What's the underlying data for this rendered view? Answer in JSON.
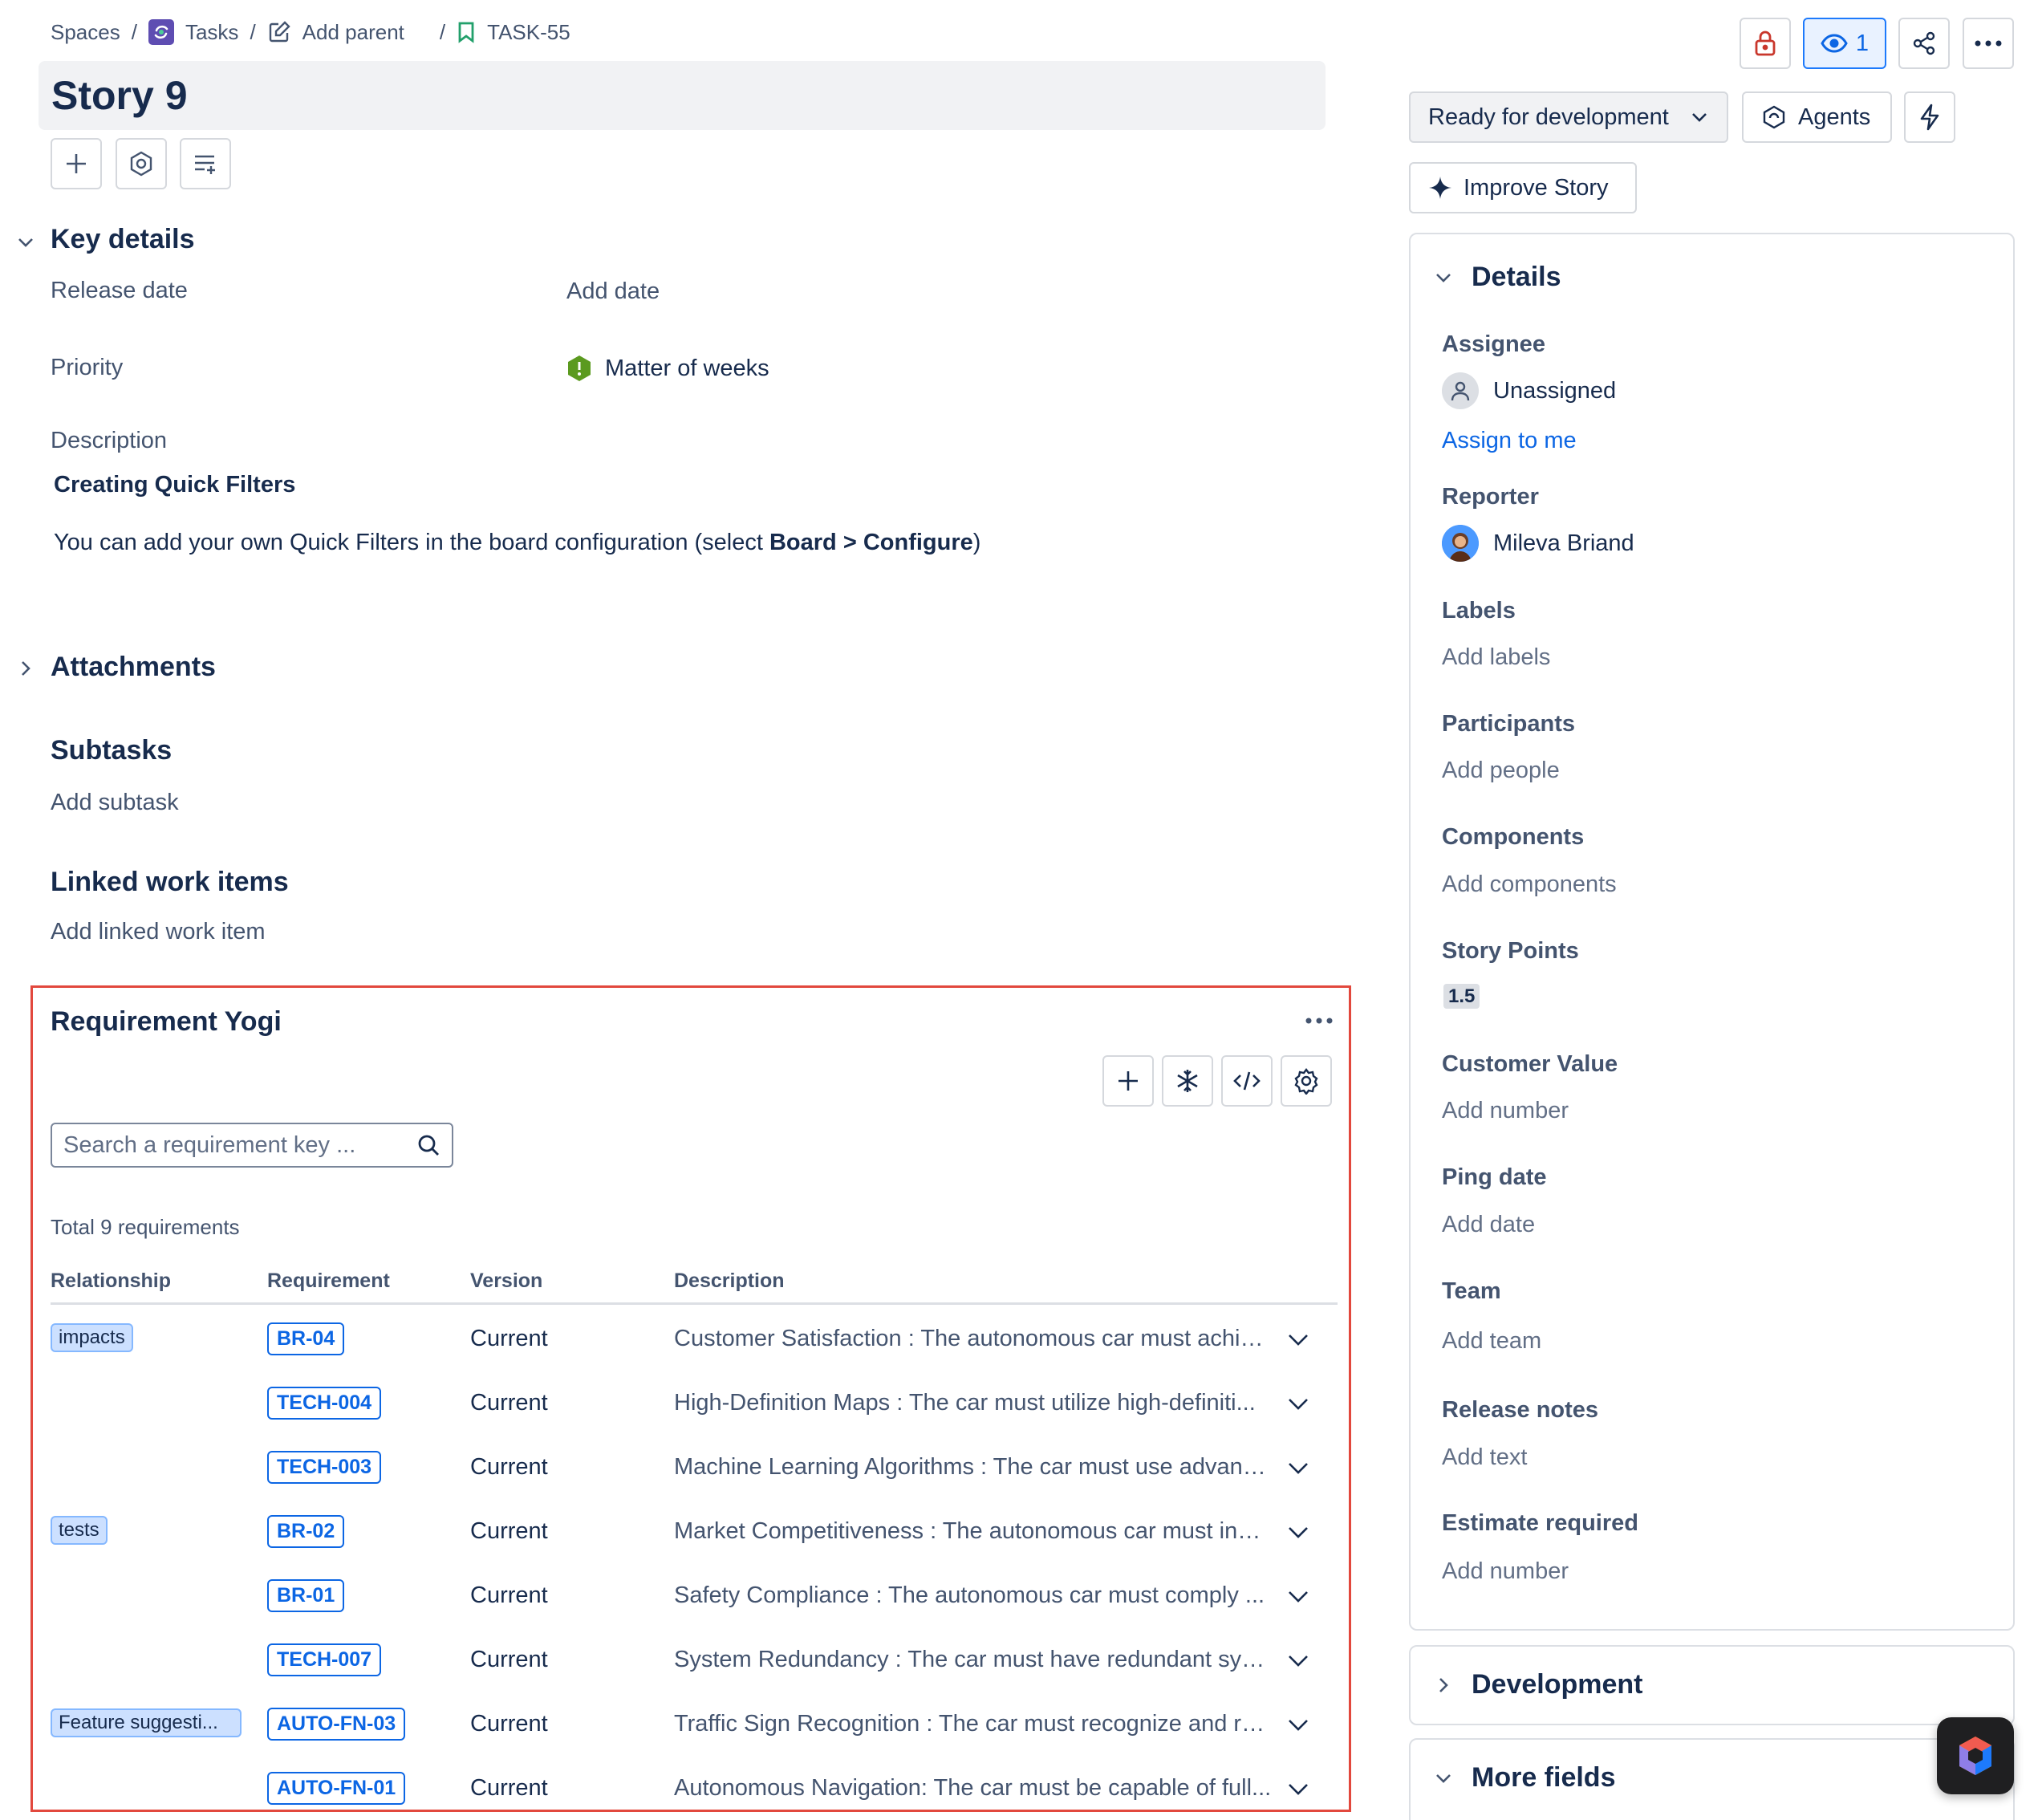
{
  "breadcrumb": {
    "spaces": "Spaces",
    "tasks": "Tasks",
    "add_parent": "Add parent",
    "key": "TASK-55",
    "separator": "/"
  },
  "title": "Story 9",
  "header_actions": {
    "watch_count": "1"
  },
  "status": {
    "label": "Ready for development",
    "agents_label": "Agents",
    "improve_label": "Improve Story"
  },
  "key_details": {
    "heading": "Key details",
    "release_date_label": "Release date",
    "release_date_value": "Add date",
    "priority_label": "Priority",
    "priority_value": "Matter of weeks",
    "description_label": "Description",
    "description_heading": "Creating Quick Filters",
    "description_text_before": "You can add your own Quick Filters in the board configuration (select ",
    "description_text_bold": "Board > Configure",
    "description_text_after": ")"
  },
  "attachments": {
    "heading": "Attachments"
  },
  "subtasks": {
    "heading": "Subtasks",
    "add": "Add subtask"
  },
  "linked": {
    "heading": "Linked work items",
    "add": "Add linked work item"
  },
  "requirement_yogi": {
    "title": "Requirement Yogi",
    "search_placeholder": "Search a requirement key ...",
    "total": "Total 9 requirements",
    "columns": {
      "relationship": "Relationship",
      "requirement": "Requirement",
      "version": "Version",
      "description": "Description"
    },
    "rows": [
      {
        "relationship": "impacts",
        "key": "BR-04",
        "version": "Current",
        "description": "Customer Satisfaction : The autonomous car must achie..."
      },
      {
        "relationship": "",
        "key": "TECH-004",
        "version": "Current",
        "description": "High-Definition Maps : The car must utilize high-definiti..."
      },
      {
        "relationship": "",
        "key": "TECH-003",
        "version": "Current",
        "description": "Machine Learning Algorithms : The car must use advanc..."
      },
      {
        "relationship": "tests",
        "key": "BR-02",
        "version": "Current",
        "description": "Market Competitiveness : The autonomous car must incl..."
      },
      {
        "relationship": "",
        "key": "BR-01",
        "version": "Current",
        "description": "Safety Compliance : The autonomous car must comply ..."
      },
      {
        "relationship": "",
        "key": "TECH-007",
        "version": "Current",
        "description": "System Redundancy : The car must have redundant syst..."
      },
      {
        "relationship": "Feature suggesti...",
        "key": "AUTO-FN-03",
        "version": "Current",
        "description": "Traffic Sign Recognition : The car must recognize and re..."
      },
      {
        "relationship": "",
        "key": "AUTO-FN-01",
        "version": "Current",
        "description": "Autonomous Navigation: The car must be capable of full..."
      }
    ]
  },
  "details": {
    "heading": "Details",
    "assignee_label": "Assignee",
    "assignee_value": "Unassigned",
    "assign_to_me": "Assign to me",
    "reporter_label": "Reporter",
    "reporter_value": "Mileva Briand",
    "labels_label": "Labels",
    "labels_value": "Add labels",
    "participants_label": "Participants",
    "participants_value": "Add people",
    "components_label": "Components",
    "components_value": "Add components",
    "story_points_label": "Story Points",
    "story_points_value": "1.5",
    "customer_value_label": "Customer Value",
    "customer_value_value": "Add number",
    "ping_date_label": "Ping date",
    "ping_date_value": "Add date",
    "team_label": "Team",
    "team_value": "Add team",
    "release_notes_label": "Release notes",
    "release_notes_value": "Add text",
    "estimate_label": "Estimate required",
    "estimate_value": "Add number"
  },
  "development": {
    "heading": "Development"
  },
  "more_fields": {
    "heading": "More fields"
  }
}
